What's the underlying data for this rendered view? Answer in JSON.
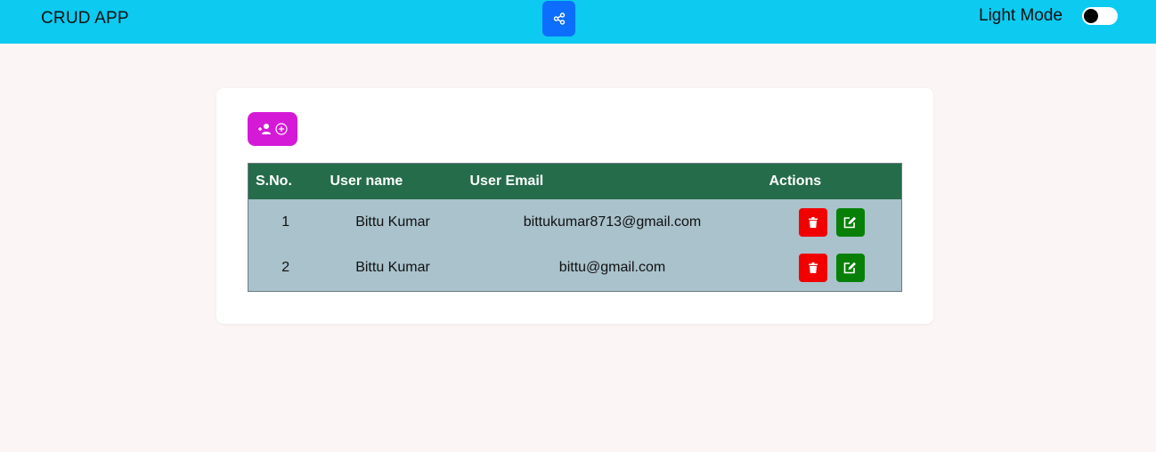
{
  "header": {
    "brand": "CRUD APP",
    "share_icon": "share-icon",
    "mode_label": "Light Mode",
    "mode_toggle_on": false,
    "colors": {
      "navbar": "#0dcaf0",
      "share_button": "#0d6efd"
    }
  },
  "toolbar": {
    "add_user_icons": [
      "user-plus-icon",
      "plus-circle-icon"
    ],
    "add_button_color": "#d51ad7"
  },
  "table": {
    "columns": [
      "S.No.",
      "User name",
      "User Email",
      "Actions"
    ],
    "rows": [
      {
        "sno": "1",
        "name": "Bittu Kumar",
        "email": "bittukumar8713@gmail.com"
      },
      {
        "sno": "2",
        "name": "Bittu Kumar",
        "email": "bittu@gmail.com"
      }
    ],
    "action_icons": [
      "trash-icon",
      "edit-icon"
    ],
    "colors": {
      "header": "#246c4a",
      "body": "#a9c2cc",
      "delete": "#f20000",
      "edit": "#088008"
    }
  }
}
